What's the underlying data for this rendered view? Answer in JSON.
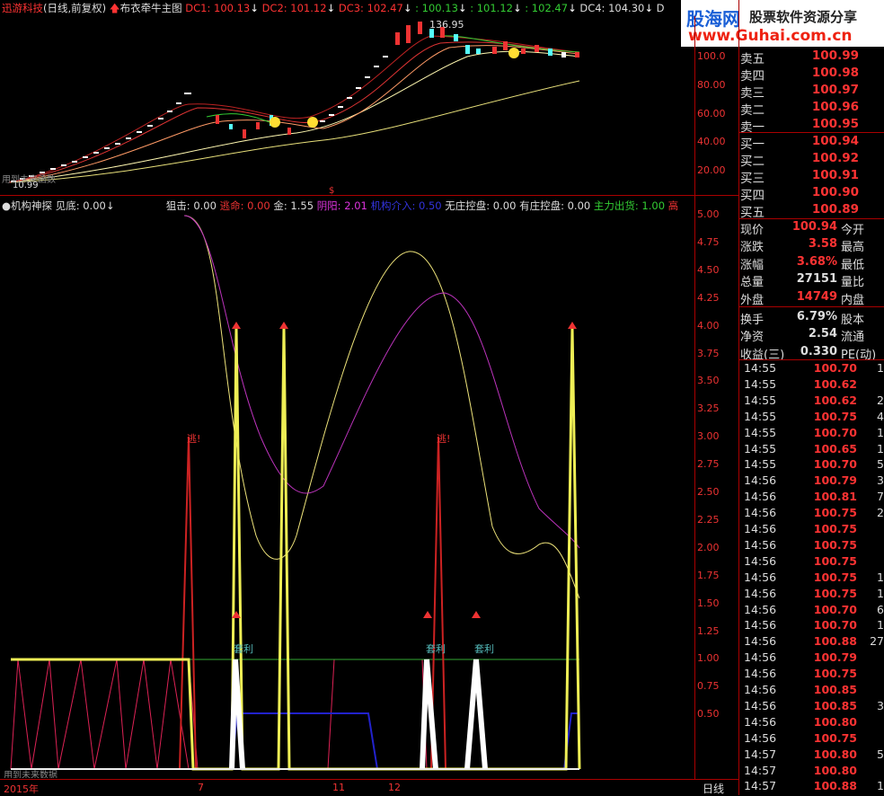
{
  "header": {
    "stock_name": "迅游科技",
    "period": "(日线,前复权)",
    "formula": "布衣牵牛主图",
    "dc1": "DC1: 100.13",
    "dc2": "DC2: 101.12",
    "dc3": "DC3: 102.47",
    "v1": ": 100.13",
    "v2": ": 101.12",
    "v3": ": 102.47",
    "dc4": "DC4: 104.30",
    "d5": "D"
  },
  "banner": {
    "logo": "股海网",
    "slogan": "股票软件资源分享",
    "url": "www.Guhai.com.cn"
  },
  "main_chart": {
    "peak_label": "136.95",
    "low_label": "10.99",
    "watermark": "用到未来函数",
    "y_ticks": [
      "100.0",
      "80.00",
      "60.00",
      "40.00",
      "20.00"
    ]
  },
  "indicator_header": {
    "name": "机构神探",
    "jiandi": "见底: 0.00",
    "juji": "狙击: 0.00",
    "taoming": "逃命: 0.00",
    "jin": "金: 1.55",
    "yinyang": "阴阳: 2.01",
    "jigou": "机构介入: 0.50",
    "wuzhuang": "无庄控盘: 0.00",
    "youzhuang": "有庄控盘: 0.00",
    "zhuli": "主力出货: 1.00",
    "gao": "高"
  },
  "indicator_chart": {
    "y_ticks": [
      "5.00",
      "4.75",
      "4.50",
      "4.25",
      "4.00",
      "3.75",
      "3.50",
      "3.25",
      "3.00",
      "2.75",
      "2.50",
      "2.25",
      "2.00",
      "1.75",
      "1.50",
      "1.25",
      "1.00",
      "0.75",
      "0.50"
    ],
    "labels": {
      "tao1": "逃!",
      "tao2": "逃!",
      "taoli1": "套利",
      "taoli2": "套利",
      "taoli3": "套利"
    },
    "watermark": "用到未来数据"
  },
  "x_axis": {
    "year": "2015年",
    "m1": "7",
    "m2": "11",
    "m3": "12",
    "period_label": "日线"
  },
  "order_book": {
    "sell": [
      {
        "label": "卖五",
        "price": "100.99"
      },
      {
        "label": "卖四",
        "price": "100.98"
      },
      {
        "label": "卖三",
        "price": "100.97"
      },
      {
        "label": "卖二",
        "price": "100.96"
      },
      {
        "label": "卖一",
        "price": "100.95"
      }
    ],
    "buy": [
      {
        "label": "买一",
        "price": "100.94"
      },
      {
        "label": "买二",
        "price": "100.92"
      },
      {
        "label": "买三",
        "price": "100.91"
      },
      {
        "label": "买四",
        "price": "100.90"
      },
      {
        "label": "买五",
        "price": "100.89"
      }
    ]
  },
  "stats": [
    {
      "l1": "现价",
      "v1": "100.94",
      "l2": "今开",
      "color": "#f33"
    },
    {
      "l1": "涨跌",
      "v1": "3.58",
      "l2": "最高",
      "color": "#f33"
    },
    {
      "l1": "涨幅",
      "v1": "3.68%",
      "l2": "最低",
      "color": "#f33"
    },
    {
      "l1": "总量",
      "v1": "27151",
      "l2": "量比",
      "color": "#ddd"
    },
    {
      "l1": "外盘",
      "v1": "14749",
      "l2": "内盘",
      "color": "#f33"
    },
    {
      "l1": "换手",
      "v1": "6.79%",
      "l2": "股本",
      "color": "#ddd"
    },
    {
      "l1": "净资",
      "v1": "2.54",
      "l2": "流通",
      "color": "#ddd"
    },
    {
      "l1": "收益(三)",
      "v1": "0.330",
      "l2": "PE(动)",
      "color": "#ddd"
    }
  ],
  "ticks": [
    {
      "t": "14:55",
      "p": "100.70",
      "v": "1",
      "c": "#f33"
    },
    {
      "t": "14:55",
      "p": "100.62",
      "v": "",
      "c": "#f33"
    },
    {
      "t": "14:55",
      "p": "100.62",
      "v": "2",
      "c": "#f33"
    },
    {
      "t": "14:55",
      "p": "100.75",
      "v": "4",
      "c": "#f33"
    },
    {
      "t": "14:55",
      "p": "100.70",
      "v": "1",
      "c": "#f33"
    },
    {
      "t": "14:55",
      "p": "100.65",
      "v": "1",
      "c": "#f33"
    },
    {
      "t": "14:55",
      "p": "100.70",
      "v": "5",
      "c": "#f33"
    },
    {
      "t": "14:56",
      "p": "100.79",
      "v": "3",
      "c": "#f33"
    },
    {
      "t": "14:56",
      "p": "100.81",
      "v": "7",
      "c": "#f33"
    },
    {
      "t": "14:56",
      "p": "100.75",
      "v": "2",
      "c": "#f33"
    },
    {
      "t": "14:56",
      "p": "100.75",
      "v": "",
      "c": "#f33"
    },
    {
      "t": "14:56",
      "p": "100.75",
      "v": "",
      "c": "#f33"
    },
    {
      "t": "14:56",
      "p": "100.75",
      "v": "",
      "c": "#f33"
    },
    {
      "t": "14:56",
      "p": "100.75",
      "v": "1",
      "c": "#f33"
    },
    {
      "t": "14:56",
      "p": "100.75",
      "v": "1",
      "c": "#f33"
    },
    {
      "t": "14:56",
      "p": "100.70",
      "v": "6",
      "c": "#f33"
    },
    {
      "t": "14:56",
      "p": "100.70",
      "v": "1",
      "c": "#f33"
    },
    {
      "t": "14:56",
      "p": "100.88",
      "v": "27",
      "c": "#f33"
    },
    {
      "t": "14:56",
      "p": "100.79",
      "v": "",
      "c": "#f33"
    },
    {
      "t": "14:56",
      "p": "100.75",
      "v": "",
      "c": "#f33"
    },
    {
      "t": "14:56",
      "p": "100.85",
      "v": "",
      "c": "#f33"
    },
    {
      "t": "14:56",
      "p": "100.85",
      "v": "3",
      "c": "#f33"
    },
    {
      "t": "14:56",
      "p": "100.80",
      "v": "",
      "c": "#f33"
    },
    {
      "t": "14:56",
      "p": "100.75",
      "v": "",
      "c": "#f33"
    },
    {
      "t": "14:57",
      "p": "100.80",
      "v": "5",
      "c": "#f33"
    },
    {
      "t": "14:57",
      "p": "100.80",
      "v": "",
      "c": "#f33"
    },
    {
      "t": "14:57",
      "p": "100.88",
      "v": "1",
      "c": "#f33"
    }
  ]
}
